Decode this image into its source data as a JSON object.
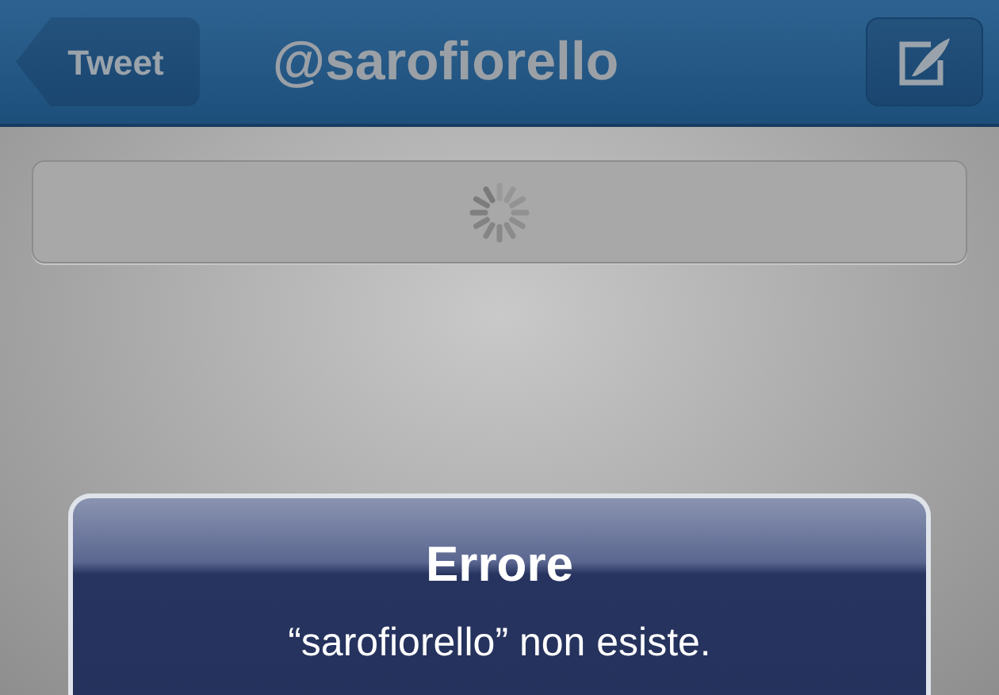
{
  "nav_bar": {
    "back_button": "Tweet",
    "title": "@sarofiorello"
  },
  "loading_card": {
    "loading": true
  },
  "alert": {
    "title": "Errore",
    "message": "“sarofiorello” non esiste."
  }
}
